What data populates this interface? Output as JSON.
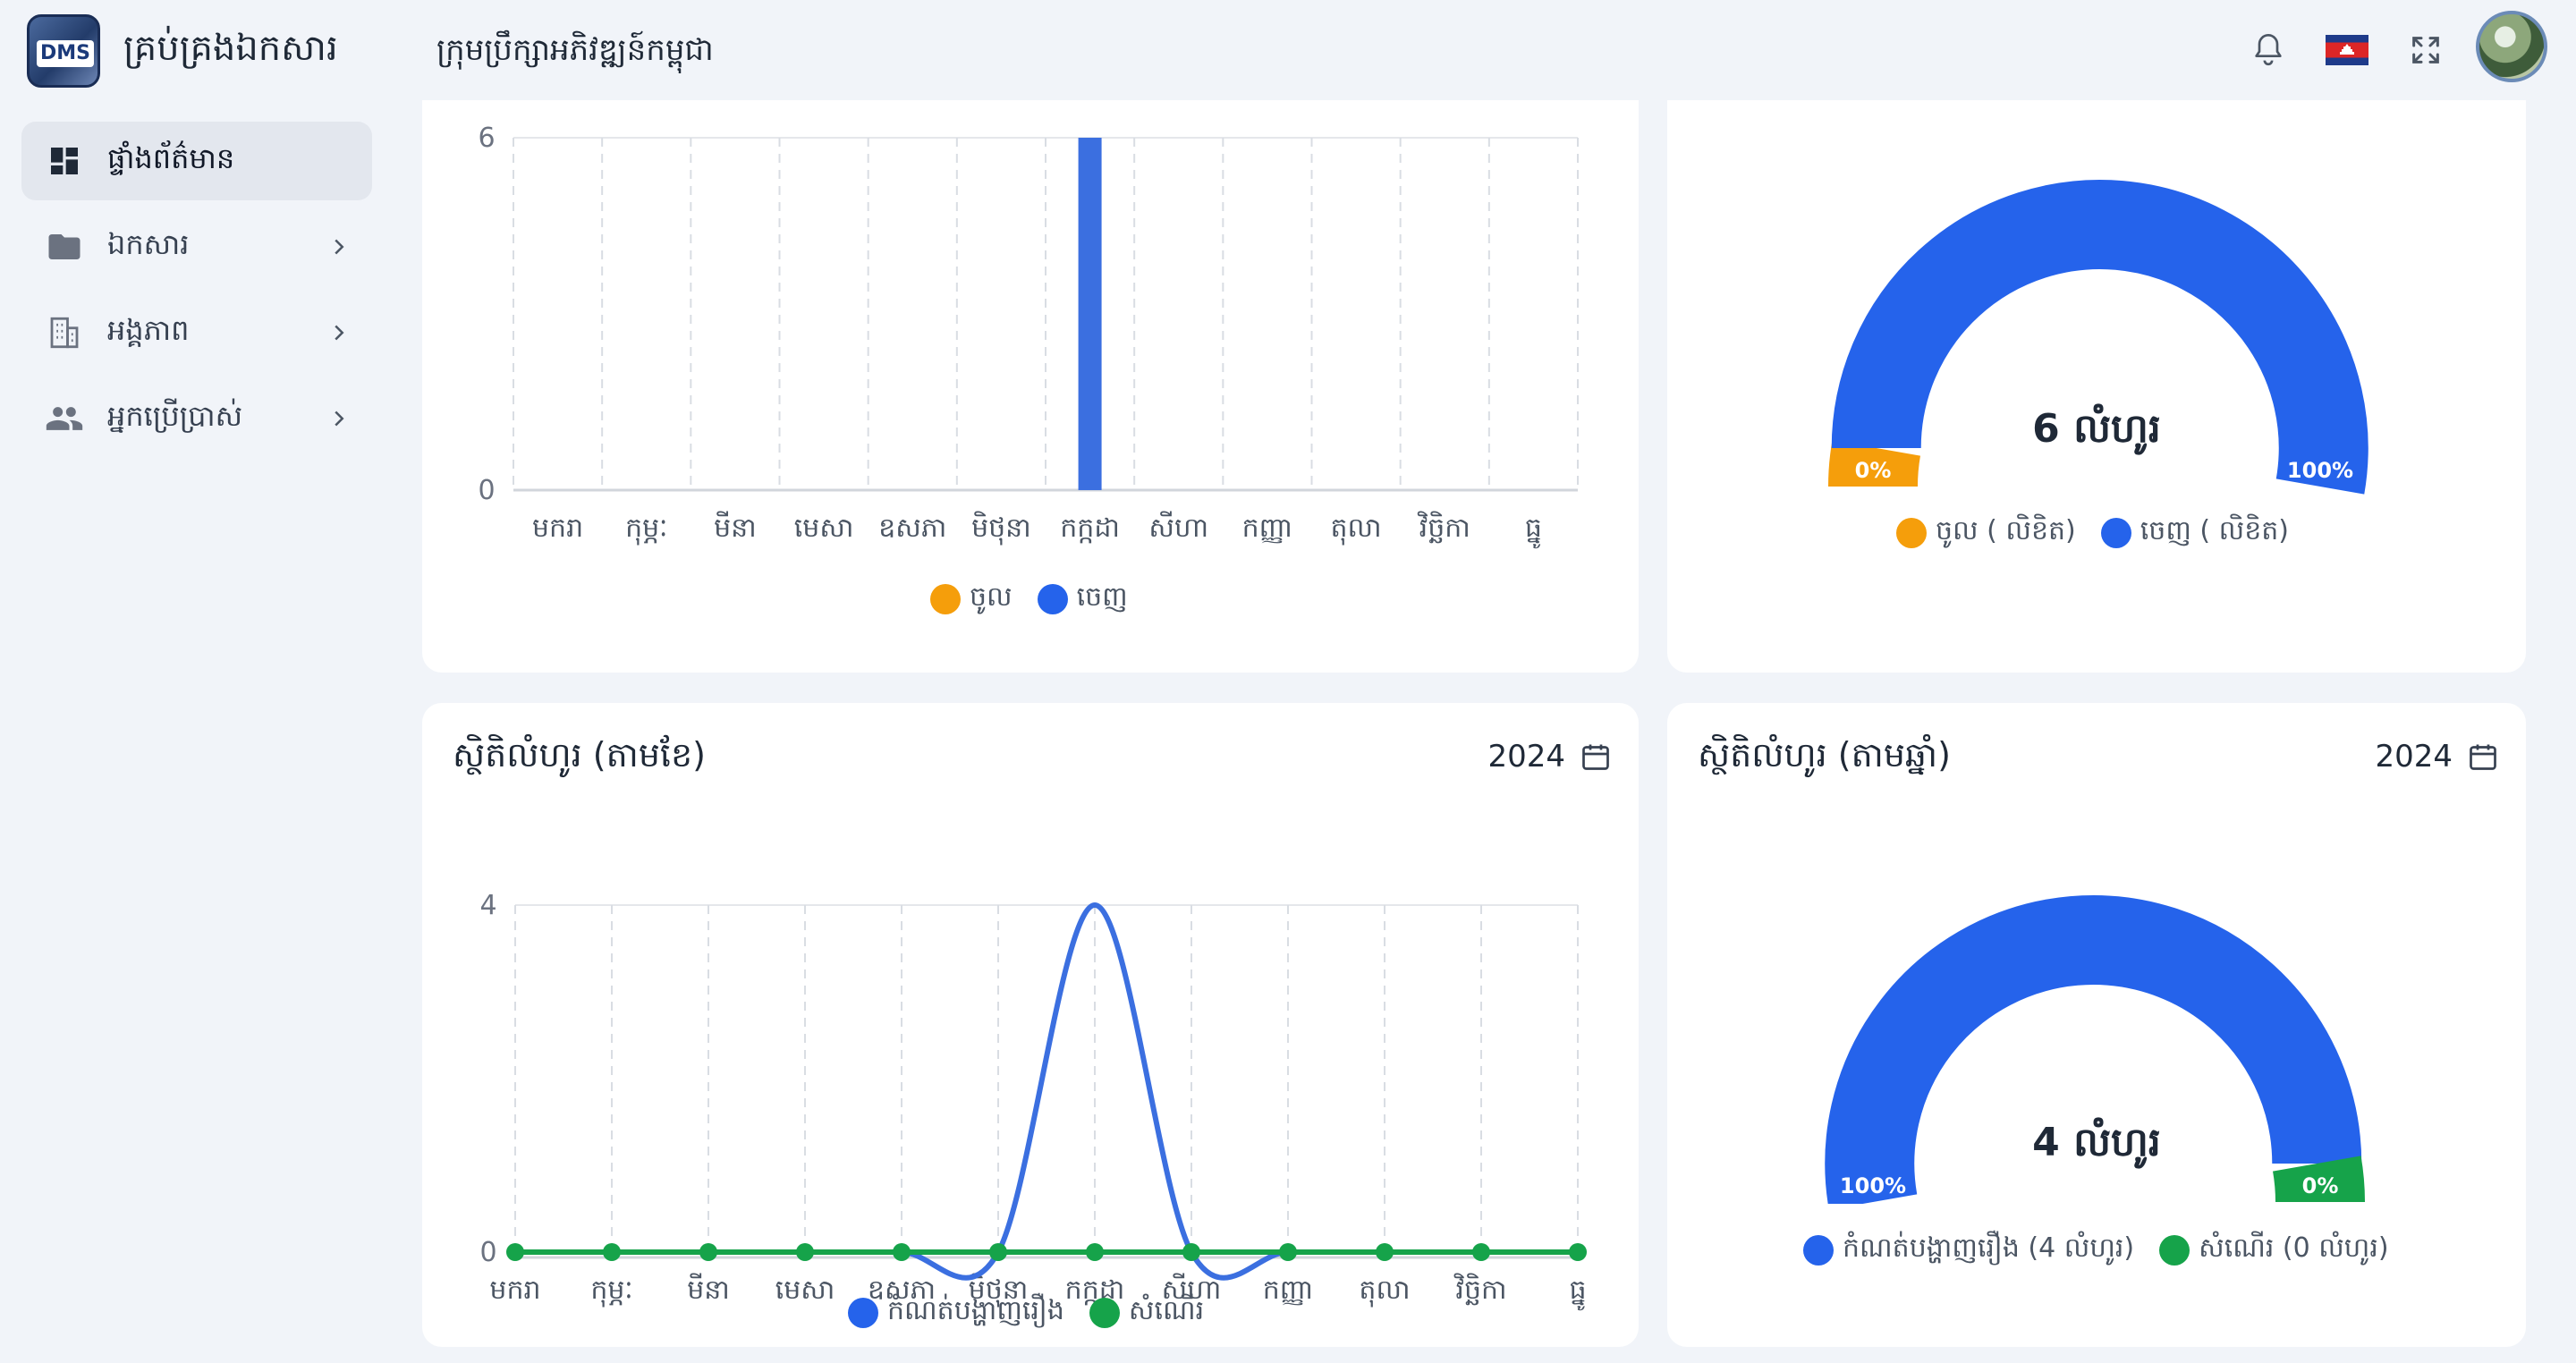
{
  "app": {
    "title": "គ្រប់គ្រងឯកសារ",
    "logo_text": "DMS",
    "organization": "ក្រុមប្រឹក្សាអភិវឌ្ឍន៍កម្ពុជា"
  },
  "header_icons": [
    "bell-icon",
    "cambodia-flag-icon",
    "fullscreen-icon",
    "user-avatar"
  ],
  "sidebar": {
    "items": [
      {
        "label": "ផ្ទាំងព័ត៌មាន",
        "icon": "dashboard-icon",
        "active": true
      },
      {
        "label": "ឯកសារ",
        "icon": "folder-icon",
        "active": false
      },
      {
        "label": "អង្គភាព",
        "icon": "building-icon",
        "active": false
      },
      {
        "label": "អ្នកប្រើប្រាស់",
        "icon": "users-icon",
        "active": false
      }
    ]
  },
  "colors": {
    "blue": "#2563eb",
    "chart_blue": "#3b6fe0",
    "orange": "#f59e0b",
    "green": "#16a34a",
    "background": "#f1f4f9"
  },
  "cards": {
    "monthly_documents": {
      "legend": [
        {
          "label": "ចូល",
          "color": "#f59e0b"
        },
        {
          "label": "ចេញ",
          "color": "#2563eb"
        }
      ]
    },
    "document_gauge": {
      "center_label": "6 លំហូរ",
      "left_pct": "0%",
      "right_pct": "100%",
      "legend": [
        {
          "label": "ចូល ( លិខិត)",
          "color": "#f59e0b"
        },
        {
          "label": "ចេញ ( លិខិត)",
          "color": "#2563eb"
        }
      ]
    },
    "flow_by_month": {
      "title": "ស្ថិតិលំហូរ (តាមខែ)",
      "year": "2024",
      "legend": [
        {
          "label": "កំណត់បង្ហាញរឿង",
          "color": "#2563eb"
        },
        {
          "label": "សំណើរ",
          "color": "#16a34a"
        }
      ]
    },
    "flow_by_year": {
      "title": "ស្ថិតិលំហូរ (តាមឆ្នាំ)",
      "year": "2024",
      "center_label": "4 លំហូរ",
      "left_pct": "100%",
      "right_pct": "0%",
      "legend": [
        {
          "label": "កំណត់បង្ហាញរឿង (4 លំហូរ)",
          "color": "#2563eb"
        },
        {
          "label": "សំណើរ (0 លំហូរ)",
          "color": "#16a34a"
        }
      ]
    }
  },
  "chart_data": [
    {
      "type": "bar",
      "categories": [
        "មករា",
        "កុម្ភៈ",
        "មីនា",
        "មេសា",
        "ឧសភា",
        "មិថុនា",
        "កក្កដា",
        "សីហា",
        "កញ្ញា",
        "តុលា",
        "វិច្ឆិកា",
        "ធ្នូ"
      ],
      "series": [
        {
          "name": "ចូល",
          "values": [
            0,
            0,
            0,
            0,
            0,
            0,
            0,
            0,
            0,
            0,
            0,
            0
          ],
          "color": "#f59e0b"
        },
        {
          "name": "ចេញ",
          "values": [
            0,
            0,
            0,
            0,
            0,
            0,
            6,
            0,
            0,
            0,
            0,
            0
          ],
          "color": "#3b6fe0"
        }
      ],
      "yticks": [
        0,
        6
      ],
      "ylim": [
        0,
        6
      ],
      "grid": true,
      "legend": "bottom"
    },
    {
      "type": "pie",
      "subtype": "semi-donut",
      "labels": [
        "ចូល ( លិខិត)",
        "ចេញ ( លិខិត)"
      ],
      "values": [
        0,
        6
      ],
      "data_labels": [
        "0%",
        "100%"
      ],
      "colors": [
        "#f59e0b",
        "#2563eb"
      ],
      "legend": "bottom"
    },
    {
      "type": "line",
      "title": "ស្ថិតិលំហូរ (តាមខែ)",
      "categories": [
        "មករា",
        "កុម្ភៈ",
        "មីនា",
        "មេសា",
        "ឧសភា",
        "មិថុនា",
        "កក្កដា",
        "សីហា",
        "កញ្ញា",
        "តុលា",
        "វិច្ឆិកា",
        "ធ្នូ"
      ],
      "series": [
        {
          "name": "កំណត់បង្ហាញរឿង",
          "values": [
            0,
            0,
            0,
            0,
            0,
            0,
            4,
            0,
            0,
            0,
            0,
            0
          ],
          "color": "#3b6fe0"
        },
        {
          "name": "សំណើរ",
          "values": [
            0,
            0,
            0,
            0,
            0,
            0,
            0,
            0,
            0,
            0,
            0,
            0
          ],
          "color": "#16a34a"
        }
      ],
      "yticks": [
        0,
        4
      ],
      "ylim": [
        0,
        4
      ],
      "grid": true,
      "legend": "bottom"
    },
    {
      "type": "pie",
      "subtype": "semi-donut",
      "title": "ស្ថិតិលំហូរ (តាមឆ្នាំ)",
      "labels": [
        "កំណត់បង្ហាញរឿង (4 លំហូរ)",
        "សំណើរ (0 លំហូរ)"
      ],
      "values": [
        4,
        0
      ],
      "data_labels": [
        "100%",
        "0%"
      ],
      "colors": [
        "#2563eb",
        "#16a34a"
      ],
      "legend": "bottom"
    }
  ]
}
